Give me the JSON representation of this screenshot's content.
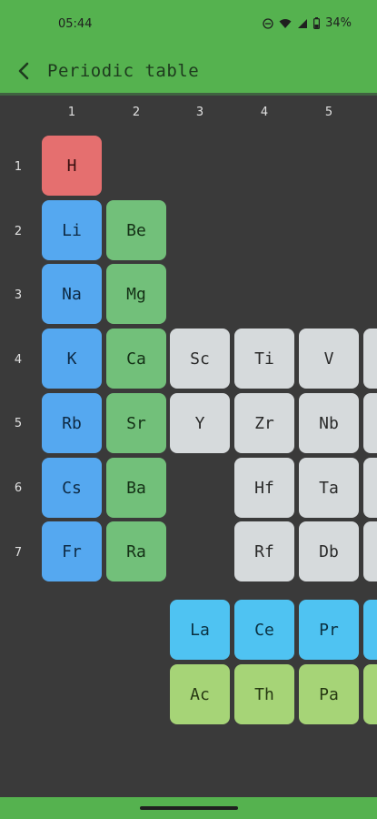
{
  "status_bar": {
    "time": "05:44",
    "battery": "34%",
    "icons": [
      "dnd-icon",
      "wifi-icon",
      "signal-icon",
      "battery-icon"
    ]
  },
  "app_bar": {
    "title": "Periodic table",
    "back_icon": "chevron-left-icon"
  },
  "grid": {
    "columns": [
      "1",
      "2",
      "3",
      "4",
      "5"
    ],
    "rows": [
      "1",
      "2",
      "3",
      "4",
      "5",
      "6",
      "7"
    ]
  },
  "elements": [
    {
      "symbol": "H",
      "category": "hydrogen"
    },
    {
      "symbol": "Li",
      "category": "alkali"
    },
    {
      "symbol": "Be",
      "category": "alkaline"
    },
    {
      "symbol": "Na",
      "category": "alkali"
    },
    {
      "symbol": "Mg",
      "category": "alkaline"
    },
    {
      "symbol": "K",
      "category": "alkali"
    },
    {
      "symbol": "Ca",
      "category": "alkaline"
    },
    {
      "symbol": "Sc",
      "category": "transition"
    },
    {
      "symbol": "Ti",
      "category": "transition"
    },
    {
      "symbol": "V",
      "category": "transition"
    },
    {
      "symbol": "Rb",
      "category": "alkali"
    },
    {
      "symbol": "Sr",
      "category": "alkaline"
    },
    {
      "symbol": "Y",
      "category": "transition"
    },
    {
      "symbol": "Zr",
      "category": "transition"
    },
    {
      "symbol": "Nb",
      "category": "transition"
    },
    {
      "symbol": "Cs",
      "category": "alkali"
    },
    {
      "symbol": "Ba",
      "category": "alkaline"
    },
    {
      "symbol": "Hf",
      "category": "transition"
    },
    {
      "symbol": "Ta",
      "category": "transition"
    },
    {
      "symbol": "Fr",
      "category": "alkali"
    },
    {
      "symbol": "Ra",
      "category": "alkaline"
    },
    {
      "symbol": "Rf",
      "category": "transition"
    },
    {
      "symbol": "Db",
      "category": "transition"
    },
    {
      "symbol": "La",
      "category": "lanthanide"
    },
    {
      "symbol": "Ce",
      "category": "lanthanide"
    },
    {
      "symbol": "Pr",
      "category": "lanthanide"
    },
    {
      "symbol": "Ac",
      "category": "actinide"
    },
    {
      "symbol": "Th",
      "category": "actinide"
    },
    {
      "symbol": "Pa",
      "category": "actinide"
    }
  ],
  "colors": {
    "app_bar": "#55b24f",
    "background": "#3a3a3a",
    "hydrogen": "#e56f6f",
    "alkali": "#55a8f0",
    "alkaline": "#72c07a",
    "transition": "#d6dadc",
    "lanthanide": "#4fc3f2",
    "actinide": "#a6d477"
  }
}
